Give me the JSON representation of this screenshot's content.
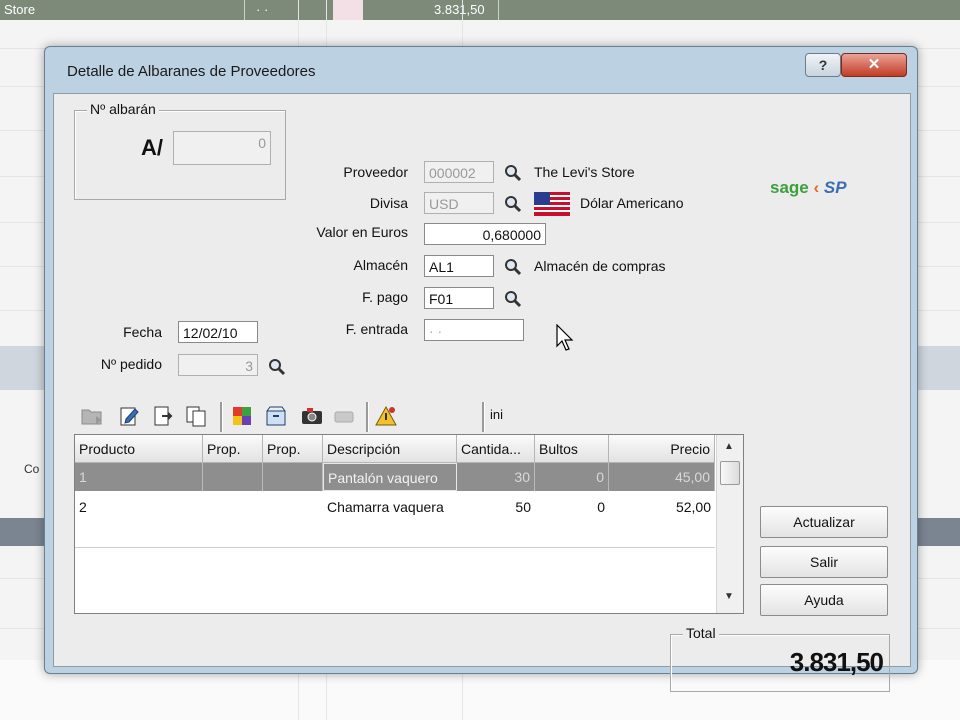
{
  "background": {
    "top_row": {
      "name": "Store",
      "dots": "· ·",
      "amount": "3.831,50"
    },
    "side_texts": [
      "Co"
    ]
  },
  "window": {
    "title": "Detalle de Albaranes de Proveedores",
    "help_label": "?",
    "close_label": "✕"
  },
  "albaran": {
    "group_label": "Nº albarán",
    "serie": "A/",
    "numero": "0"
  },
  "form": {
    "proveedor": {
      "label": "Proveedor",
      "code": "000002",
      "name": "The Levi's Store"
    },
    "divisa": {
      "label": "Divisa",
      "code": "USD",
      "name": "Dólar Americano"
    },
    "valor_euros": {
      "label": "Valor en Euros",
      "value": "0,680000"
    },
    "almacen": {
      "label": "Almacén",
      "code": "AL1",
      "name": "Almacén de compras"
    },
    "forma_pago": {
      "label": "F. pago",
      "code": "F01"
    },
    "fecha_entrada": {
      "label": "F. entrada",
      "value": "· ·"
    },
    "fecha": {
      "label": "Fecha",
      "value": "12/02/10"
    },
    "pedido": {
      "label": "Nº pedido",
      "value": "3"
    }
  },
  "logo": {
    "text_left": "sage",
    "text_right": "SP"
  },
  "toolbar_label": "ini",
  "grid": {
    "columns": [
      "Producto",
      "Prop.",
      "Prop.",
      "Descripción",
      "Cantida...",
      "Bultos",
      "Precio"
    ],
    "rows": [
      {
        "producto": "1",
        "prop1": "",
        "prop2": "",
        "descripcion": "Pantalón vaquero",
        "cantidad": "30",
        "bultos": "0",
        "precio": "45,00"
      },
      {
        "producto": "2",
        "prop1": "",
        "prop2": "",
        "descripcion": "Chamarra vaquera",
        "cantidad": "50",
        "bultos": "0",
        "precio": "52,00"
      }
    ]
  },
  "buttons": {
    "actualizar": "Actualizar",
    "salir": "Salir",
    "ayuda": "Ayuda"
  },
  "total": {
    "label": "Total",
    "value": "3.831,50"
  },
  "colors": {
    "title_bar": "#bcd1e2",
    "selected_row": "#8e8e8e",
    "close_button": "#c23b25",
    "logo_green": "#3aa13c"
  }
}
